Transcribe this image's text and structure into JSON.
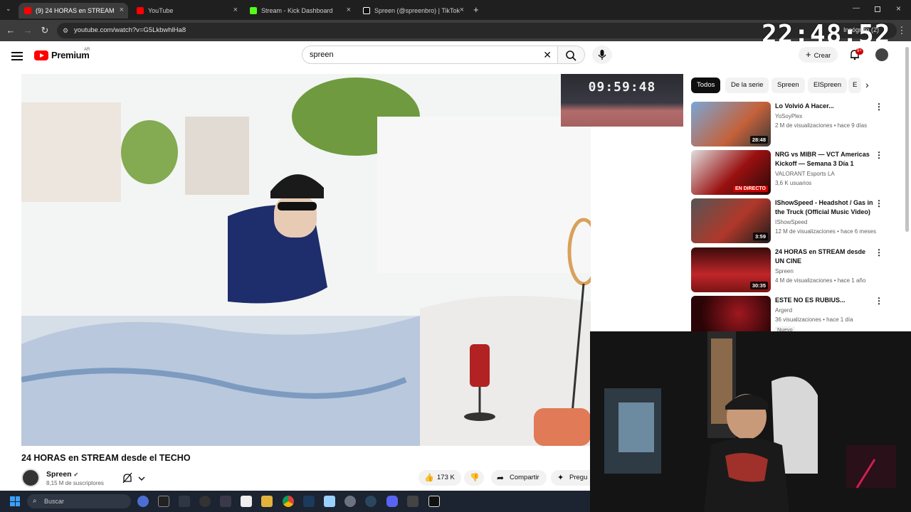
{
  "browser": {
    "tabs": [
      {
        "label": "(9) 24 HORAS en STREAM desde",
        "active": true,
        "color": "#ff0000"
      },
      {
        "label": "YouTube",
        "active": false,
        "color": "#ff0000"
      },
      {
        "label": "Stream - Kick Dashboard",
        "active": false,
        "color": "#53fc18"
      },
      {
        "label": "Spreen (@spreenbro) | TikTok",
        "active": false,
        "color": "#ffffff"
      }
    ],
    "url": "youtube.com/watch?v=G5LkbwhlHa8",
    "clock": "22:48:52",
    "incognito": "Incógnito (2)"
  },
  "youtube": {
    "logo": "Premium",
    "region": "AR",
    "search_value": "spreen",
    "create_label": "Crear",
    "notifications": "9+"
  },
  "video": {
    "timer": "09:59:48",
    "title": "24 HORAS en STREAM desde el TECHO",
    "channel": "Spreen",
    "subscribers": "8,15 M de suscriptores",
    "likes": "173 K",
    "share": "Compartir",
    "ask": "Pregu"
  },
  "chips": [
    "Todos",
    "De la serie",
    "Spreen",
    "ElSpreen",
    "E"
  ],
  "recommendations": [
    {
      "title": "Lo Volvió A Hacer...",
      "channel": "YoSoyPlex",
      "meta": "2 M de visualizaciones • hace 9 días",
      "duration": "28:48",
      "thumb": "#5a7ea8"
    },
    {
      "title": "NRG vs MIBR — VCT Americas Kickoff — Semana 3 Día 1",
      "channel": "VALORANT Esports LA",
      "meta": "3,6 K usuarios",
      "duration": "EN DIRECTO",
      "thumb": "#7a1818"
    },
    {
      "title": "IShowSpeed - Headshot / Gas in the Truck (Official Music Video)",
      "channel": "IShowSpeed",
      "meta": "12 M de visualizaciones • hace 6 meses",
      "duration": "3:59",
      "thumb": "#8a3a2a"
    },
    {
      "title": "24 HORAS en STREAM desde UN CINE",
      "channel": "Spreen",
      "meta": "4 M de visualizaciones • hace 1 año",
      "duration": "30:35",
      "thumb": "#b3262a"
    },
    {
      "title": "ESTE NO ES RUBIUS...",
      "channel": "Argerd",
      "meta": "36 visualizaciones • hace 1 día",
      "duration": "",
      "thumb": "#6a0c10",
      "badge": "Nuevo"
    }
  ],
  "taskbar": {
    "search_placeholder": "Buscar"
  }
}
